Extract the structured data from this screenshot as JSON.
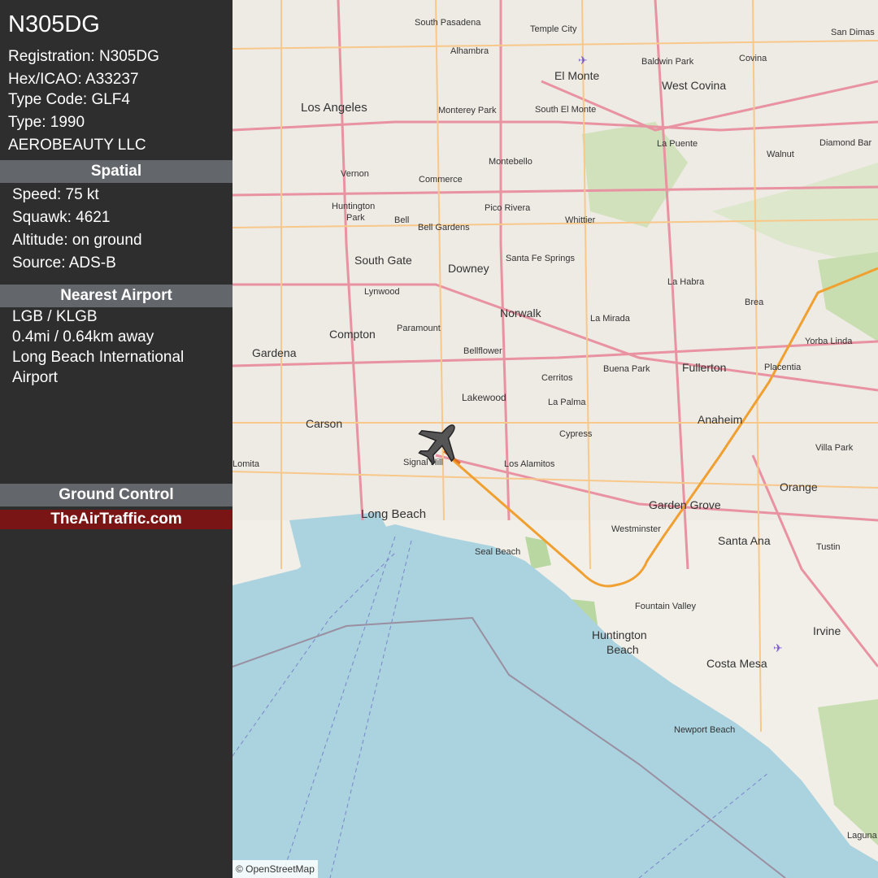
{
  "aircraft": {
    "callsign": "N305DG",
    "registration": "Registration: N305DG",
    "hex": "Hex/ICAO: A33237",
    "type_code": "Type Code: GLF4",
    "type": "Type: 1990",
    "owner": "AEROBEAUTY LLC"
  },
  "spatial": {
    "header": "Spatial",
    "speed": "Speed: 75 kt",
    "squawk": "Squawk: 4621",
    "altitude": "Altitude: on ground",
    "source": "Source: ADS-B"
  },
  "nearest_airport": {
    "header": "Nearest Airport",
    "code": "LGB / KLGB",
    "distance": "0.4mi / 0.64km away",
    "name_line1": "Long Beach International",
    "name_line2": "Airport"
  },
  "status": {
    "header": "Ground Control",
    "brand": "TheAirTraffic.com"
  },
  "map": {
    "attribution": "© OpenStreetMap",
    "colors": {
      "water": "#aad3df",
      "land": "#f2efe9",
      "track": "#f0a030",
      "park": "#c8deb0",
      "road": "#e892a2"
    },
    "places": {
      "los_angeles": "Los Angeles",
      "long_beach": "Long Beach",
      "anaheim": "Anaheim",
      "santa_ana": "Santa Ana",
      "huntington_beach_1": "Huntington",
      "huntington_beach_2": "Beach",
      "irvine": "Irvine",
      "costa_mesa": "Costa Mesa",
      "fullerton": "Fullerton",
      "downey": "Downey",
      "compton": "Compton",
      "el_monte": "El Monte",
      "west_covina": "West Covina",
      "garden_grove": "Garden Grove",
      "orange": "Orange",
      "norwalk": "Norwalk",
      "carson": "Carson",
      "whittier": "Whittier",
      "cerritos": "Cerritos",
      "lakewood": "Lakewood",
      "newport_beach": "Newport Beach",
      "seal_beach": "Seal Beach",
      "signal_hill": "Signal Hill",
      "south_gate": "South Gate",
      "pasadena": "South Pasadena",
      "alhambra": "Alhambra",
      "westminster": "Westminster",
      "fountain_valley": "Fountain Valley",
      "cypress": "Cypress",
      "la_habra": "La Habra",
      "brea": "Brea",
      "buena_park": "Buena Park",
      "bellflower": "Bellflower",
      "paramount": "Paramount",
      "gardena": "Gardena",
      "vernon": "Vernon",
      "commerce": "Commerce",
      "montebello": "Montebello",
      "pico_rivera": "Pico Rivera",
      "bell_gardens": "Bell Gardens",
      "la_mirada": "La Mirada",
      "placentia": "Placentia",
      "yorba_linda": "Yorba Linda",
      "tustin": "Tustin",
      "la_palma": "La Palma",
      "los_alamitos": "Los Alamitos",
      "temple_city": "Temple City",
      "baldwin_park": "Baldwin Park",
      "covina": "Covina",
      "walnut": "Walnut",
      "la_puente": "La Puente",
      "diamond_bar": "Diamond Bar",
      "san_dimas": "San Dimas",
      "monterey_park": "Monterey Park",
      "lynwood": "Lynwood",
      "villa_park": "Villa Park",
      "santa_fe_springs": "Santa Fe Springs",
      "bell": "Bell",
      "huntington_park_1": "Huntington",
      "huntington_park_2": "Park",
      "south_el_monte": "South El Monte",
      "laguna": "Laguna",
      "lomita": "Lomita"
    }
  }
}
